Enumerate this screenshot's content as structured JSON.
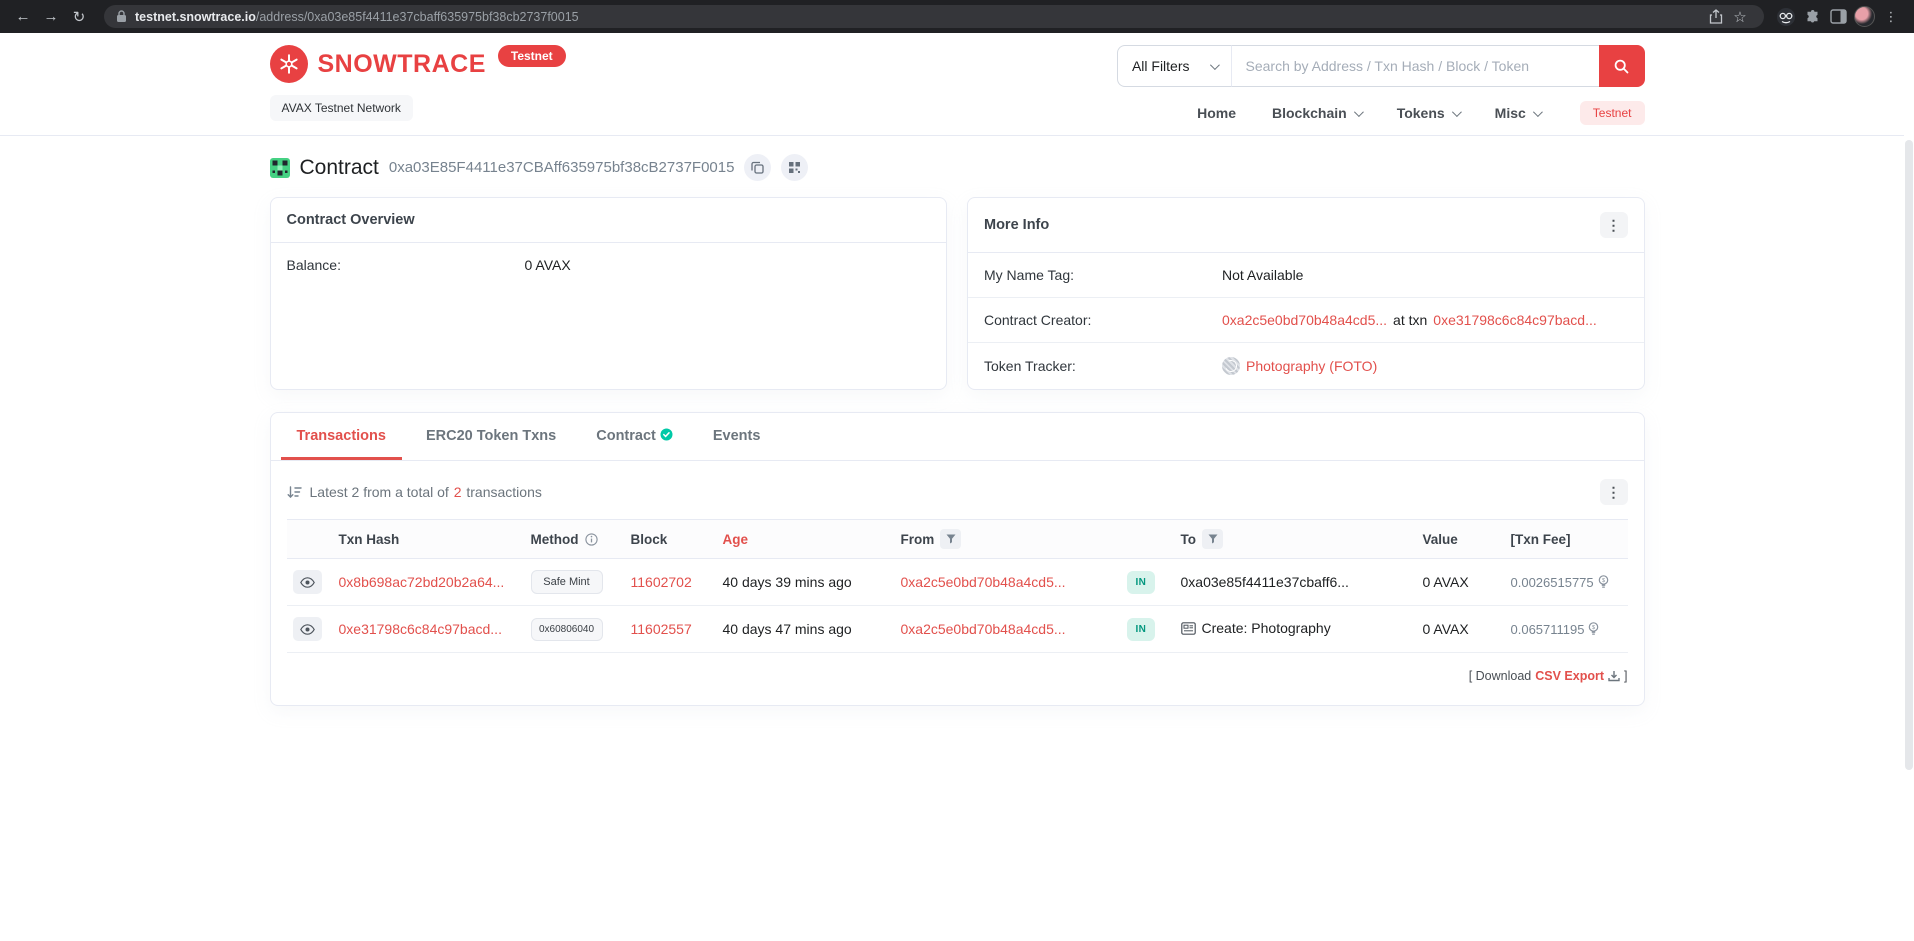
{
  "browser": {
    "url_domain": "testnet.snowtrace.io",
    "url_path": "/address/0xa03e85f4411e37cbaff635975bf38cb2737f0015"
  },
  "header": {
    "brand": "SNOWTRACE",
    "brand_badge": "Testnet",
    "network": "AVAX Testnet Network",
    "search": {
      "filter": "All Filters",
      "placeholder": "Search by Address / Txn Hash / Block / Token"
    },
    "nav": {
      "home": "Home",
      "blockchain": "Blockchain",
      "tokens": "Tokens",
      "misc": "Misc",
      "testnet": "Testnet"
    }
  },
  "page": {
    "title": "Contract",
    "address": "0xa03E85F4411e37CBAff635975bf38cB2737F0015"
  },
  "overview": {
    "title": "Contract Overview",
    "balance_label": "Balance:",
    "balance_value": "0 AVAX"
  },
  "more_info": {
    "title": "More Info",
    "name_tag_label": "My Name Tag:",
    "name_tag_value": "Not Available",
    "creator_label": "Contract Creator:",
    "creator_address": "0xa2c5e0bd70b48a4cd5...",
    "creator_infix": "at txn",
    "creator_txn": "0xe31798c6c84c97bacd...",
    "tracker_label": "Token Tracker:",
    "tracker_value": "Photography (FOTO)"
  },
  "tabs": {
    "transactions": "Transactions",
    "erc20": "ERC20 Token Txns",
    "contract": "Contract",
    "events": "Events"
  },
  "txns": {
    "summary_prefix": "Latest 2 from a total of",
    "summary_count": "2",
    "summary_suffix": "transactions",
    "columns": {
      "hash": "Txn Hash",
      "method": "Method",
      "block": "Block",
      "age": "Age",
      "from": "From",
      "to": "To",
      "value": "Value",
      "fee": "[Txn Fee]"
    },
    "rows": [
      {
        "hash": "0x8b698ac72bd20b2a64...",
        "method": "Safe Mint",
        "block": "11602702",
        "age": "40 days 39 mins ago",
        "from": "0xa2c5e0bd70b48a4cd5...",
        "direction": "IN",
        "to": "0xa03e85f4411e37cbaff6...",
        "value": "0 AVAX",
        "fee": "0.0026515775"
      },
      {
        "hash": "0xe31798c6c84c97bacd...",
        "method": "0x60806040",
        "block": "11602557",
        "age": "40 days 47 mins ago",
        "from": "0xa2c5e0bd70b48a4cd5...",
        "direction": "IN",
        "to": "Create: Photography",
        "value": "0 AVAX",
        "fee": "0.065711195"
      }
    ],
    "download_open": "[ Download",
    "download_link": "CSV Export",
    "download_close": "]"
  },
  "colors": {
    "brand_red": "#e84142",
    "link_red": "#e2504c",
    "in_badge_bg": "#d8f3ec",
    "in_badge_text": "#02977e",
    "card_border": "#e7eaf3",
    "text_dark": "#1e2022",
    "text_muted": "#77838f",
    "chrome_bg": "#202124"
  }
}
